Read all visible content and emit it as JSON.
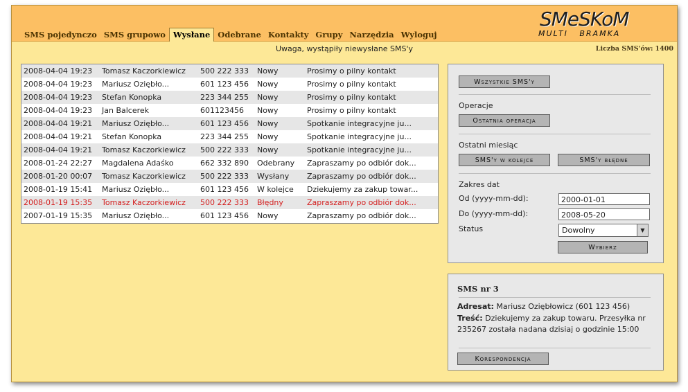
{
  "nav": [
    {
      "label": "SMS pojedynczo",
      "active": false
    },
    {
      "label": "SMS grupowo",
      "active": false
    },
    {
      "label": "Wysłane",
      "active": true
    },
    {
      "label": "Odebrane",
      "active": false
    },
    {
      "label": "Kontakty",
      "active": false
    },
    {
      "label": "Grupy",
      "active": false
    },
    {
      "label": "Narzędzia",
      "active": false
    },
    {
      "label": "Wyloguj",
      "active": false
    }
  ],
  "logo": {
    "main": "SMeSKoM",
    "sub": "MULTI   BRAMKA"
  },
  "warning": "Uwaga, wystąpiły niewysłane SMS'y",
  "counter": {
    "label": "Liczba SMS'ów:",
    "value": "1400"
  },
  "messages": [
    {
      "date": "2008-04-04 19:23",
      "name": "Tomasz Kaczorkiewicz",
      "phone": "500 222 333",
      "status": "Nowy",
      "text": "Prosimy o pilny kontakt",
      "error": false
    },
    {
      "date": "2008-04-04 19:23",
      "name": "Mariusz Oziębło...",
      "phone": "601 123 456",
      "status": "Nowy",
      "text": "Prosimy o pilny kontakt",
      "error": false
    },
    {
      "date": "2008-04-04 19:23",
      "name": "Stefan Konopka",
      "phone": "223 344 255",
      "status": "Nowy",
      "text": "Prosimy o pilny kontakt",
      "error": false
    },
    {
      "date": "2008-04-04 19:23",
      "name": "Jan Balcerek",
      "phone": "601123456",
      "status": "Nowy",
      "text": "Prosimy o pilny kontakt",
      "error": false
    },
    {
      "date": "2008-04-04 19:21",
      "name": "Mariusz Oziębło...",
      "phone": "601 123 456",
      "status": "Nowy",
      "text": "Spotkanie integracyjne ju...",
      "error": false
    },
    {
      "date": "2008-04-04 19:21",
      "name": "Stefan Konopka",
      "phone": "223 344 255",
      "status": "Nowy",
      "text": "Spotkanie integracyjne ju...",
      "error": false
    },
    {
      "date": "2008-04-04 19:21",
      "name": "Tomasz Kaczorkiewicz",
      "phone": "500 222 333",
      "status": "Nowy",
      "text": "Spotkanie integracyjne ju...",
      "error": false
    },
    {
      "date": "2008-01-24 22:27",
      "name": "Magdalena Adaśko",
      "phone": "662 332 890",
      "status": "Odebrany",
      "text": "Zapraszamy po odbiór dok...",
      "error": false
    },
    {
      "date": "2008-01-20 00:07",
      "name": "Tomasz Kaczorkiewicz",
      "phone": "500 222 333",
      "status": "Wysłany",
      "text": "Zapraszamy po odbiór dok...",
      "error": false
    },
    {
      "date": "2008-01-19 15:41",
      "name": "Mariusz Oziębło...",
      "phone": "601 123 456",
      "status": "W kolejce",
      "text": "Dziekujemy za zakup towar...",
      "error": false
    },
    {
      "date": "2008-01-19 15:35",
      "name": "Tomasz Kaczorkiewicz",
      "phone": "500 222 333",
      "status": "Błędny",
      "text": "Zapraszamy po odbiór dok...",
      "error": true
    },
    {
      "date": "2007-01-19 15:35",
      "name": "Mariusz Oziębło...",
      "phone": "601 123 456",
      "status": "Nowy",
      "text": "Zapraszamy po odbiór dok...",
      "error": false
    }
  ],
  "filters": {
    "all_button": "Wszystkie SMS'y",
    "operations_label": "Operacje",
    "last_op_button": "Ostatnia operacja",
    "last_month_label": "Ostatni miesiąc",
    "queue_button": "SMS'y w kolejce",
    "errors_button": "SMS'y błędne",
    "date_range_label": "Zakres dat",
    "from_label": "Od (yyyy-mm-dd):",
    "from_value": "2000-01-01",
    "to_label": "Do (yyyy-mm-dd):",
    "to_value": "2008-05-20",
    "status_label": "Status",
    "status_value": "Dowolny",
    "choose_button": "Wybierz"
  },
  "detail": {
    "title": "SMS nr 3",
    "recipient_label": "Adresat:",
    "recipient_value": "Mariusz Oziębłowicz (601 123 456)",
    "content_label": "Treść:",
    "content_value": "Dziekujemy za zakup towaru. Przesyłka nr 235267 została nadana dzisiaj o godzinie 15:00",
    "correspondence_button": "Korespondencja"
  }
}
